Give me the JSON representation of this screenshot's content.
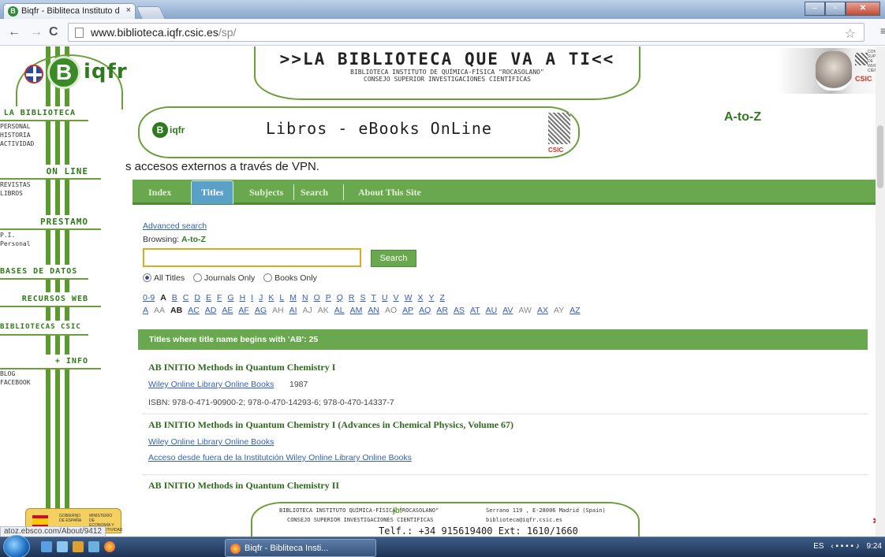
{
  "browser": {
    "tab_title": "Biqfr - Biblitecа Instituto d",
    "tab_close": "×",
    "url_domain": "www.biblioteca.iqfr.csic.es",
    "url_path": "/sp/",
    "back": "←",
    "forward": "→",
    "reload": "C",
    "star": "☆",
    "menu": "≡",
    "status_url": "atoz.ebsco.com/About/9412"
  },
  "sidebar": {
    "logo_text": "iqfr",
    "logo_letter": "B",
    "sections": [
      {
        "title": "La Biblioteca",
        "items": [
          "PERSONAL",
          "HISTORIA",
          "ACTIVIDAD"
        ]
      },
      {
        "title": "On Line",
        "items": [
          "REVISTAS",
          "LIBROS"
        ]
      },
      {
        "title": "Prestamo",
        "items": [
          "P.I.",
          "Personal"
        ]
      },
      {
        "title": "Bases de Datos",
        "items": []
      },
      {
        "title": "Recursos Web",
        "items": []
      },
      {
        "title": "Bibliotecas CSIC",
        "items": []
      },
      {
        "title": "+ Info",
        "items": [
          "BLOG",
          "FACEBOOK"
        ]
      }
    ],
    "ministry_text_1": "GOBIERNO DE ESPAÑA",
    "ministry_text_2": "MINISTERIO DE ECONOMÍA Y COMPETITIVIDAD"
  },
  "banner": {
    "title": ">>LA BIBLIOTECA QUE VA A TI<<",
    "line1": "BIBLIOTECA INSTITUTO DE QUÍMICA-FÍSICA \"ROCASOLANO\"",
    "line2": "CONSEJO SUPERIOR INVESTIGACIONES CIENTÍFICAS",
    "csic_caption": "CONSEJO SUPERIOR DE INVESTIGACIONES CIENTÍFICAS",
    "csic_short": "CSIC"
  },
  "section_banner": {
    "logo_text": "iqfr",
    "logo_letter": "B",
    "title": "Libros - eBooks OnLine",
    "csic": "CSIC",
    "atoz": "A-to-Z"
  },
  "vpn_notice": "s accesos externos a través de VPN.",
  "nav": {
    "tabs": [
      "Index",
      "Titles",
      "Subjects",
      "Search",
      "About This Site"
    ],
    "active": "Titles"
  },
  "search": {
    "advanced_label": "Advanced search",
    "browsing_prefix": "Browsing:",
    "browsing_value": "A-to-Z",
    "query": "",
    "button": "Search",
    "options": [
      "All Titles",
      "Journals Only",
      "Books Only"
    ],
    "selected_option": "All Titles"
  },
  "alphabet": {
    "row1": [
      {
        "t": "0-9",
        "s": "link"
      },
      {
        "t": "A",
        "s": "current"
      },
      {
        "t": "B",
        "s": "link"
      },
      {
        "t": "C",
        "s": "link"
      },
      {
        "t": "D",
        "s": "link"
      },
      {
        "t": "E",
        "s": "link"
      },
      {
        "t": "F",
        "s": "link"
      },
      {
        "t": "G",
        "s": "link"
      },
      {
        "t": "H",
        "s": "link"
      },
      {
        "t": "I",
        "s": "link"
      },
      {
        "t": "J",
        "s": "link"
      },
      {
        "t": "K",
        "s": "link"
      },
      {
        "t": "L",
        "s": "link"
      },
      {
        "t": "M",
        "s": "link"
      },
      {
        "t": "N",
        "s": "link"
      },
      {
        "t": "O",
        "s": "link"
      },
      {
        "t": "P",
        "s": "link"
      },
      {
        "t": "Q",
        "s": "link"
      },
      {
        "t": "R",
        "s": "link"
      },
      {
        "t": "S",
        "s": "link"
      },
      {
        "t": "T",
        "s": "link"
      },
      {
        "t": "U",
        "s": "link"
      },
      {
        "t": "V",
        "s": "link"
      },
      {
        "t": "W",
        "s": "link"
      },
      {
        "t": "X",
        "s": "link"
      },
      {
        "t": "Y",
        "s": "link"
      },
      {
        "t": "Z",
        "s": "link"
      }
    ],
    "row2": [
      {
        "t": "A",
        "s": "link"
      },
      {
        "t": "AA",
        "s": "disabled"
      },
      {
        "t": "AB",
        "s": "current"
      },
      {
        "t": "AC",
        "s": "link"
      },
      {
        "t": "AD",
        "s": "link"
      },
      {
        "t": "AE",
        "s": "link"
      },
      {
        "t": "AF",
        "s": "link"
      },
      {
        "t": "AG",
        "s": "link"
      },
      {
        "t": "AH",
        "s": "disabled"
      },
      {
        "t": "AI",
        "s": "link"
      },
      {
        "t": "AJ",
        "s": "disabled"
      },
      {
        "t": "AK",
        "s": "disabled"
      },
      {
        "t": "AL",
        "s": "link"
      },
      {
        "t": "AM",
        "s": "link"
      },
      {
        "t": "AN",
        "s": "link"
      },
      {
        "t": "AO",
        "s": "disabled"
      },
      {
        "t": "AP",
        "s": "link"
      },
      {
        "t": "AQ",
        "s": "link"
      },
      {
        "t": "AR",
        "s": "link"
      },
      {
        "t": "AS",
        "s": "link"
      },
      {
        "t": "AT",
        "s": "link"
      },
      {
        "t": "AU",
        "s": "link"
      },
      {
        "t": "AV",
        "s": "link"
      },
      {
        "t": "AW",
        "s": "disabled"
      },
      {
        "t": "AX",
        "s": "link"
      },
      {
        "t": "AY",
        "s": "disabled"
      },
      {
        "t": "AZ",
        "s": "link"
      }
    ]
  },
  "results": {
    "header": "Titles where title name begins with 'AB': 25",
    "items": [
      {
        "title": "AB INITIO Methods in Quantum Chemistry I",
        "source": "Wiley Online Library Online Books",
        "year": "1987",
        "isbn": "ISBN: 978-0-471-90900-2; 978-0-470-14293-6; 978-0-470-14337-7"
      },
      {
        "title": "AB INITIO Methods in Quantum Chemistry I (Advances in Chemical Physics, Volume 67)",
        "source": "Wiley Online Library Online Books",
        "external": "Acceso desde fuera de la Institutción Wiley Online Library Online Books"
      },
      {
        "title": "AB INITIO Methods in Quantum Chemistry II"
      }
    ]
  },
  "footer": {
    "line1": "BIBLIOTECA INSTITUTO QUÍMICA-FÍSICA \"ROCASOLANO\"",
    "line2": "CONSEJO SUPERIOR INVESTIGACIONES CIENTIFICAS",
    "address": "Serrano 119 , E-28006 Madrid (Spain)",
    "email": "biblioteca@iqfr.csic.es",
    "phone": "Telf.: +34 915619400 Ext: 1610/1660",
    "jbi": "jbi"
  },
  "taskbar": {
    "item": "Biqfr - Biblitecа Insti...",
    "lang": "ES",
    "time": "9:24"
  }
}
